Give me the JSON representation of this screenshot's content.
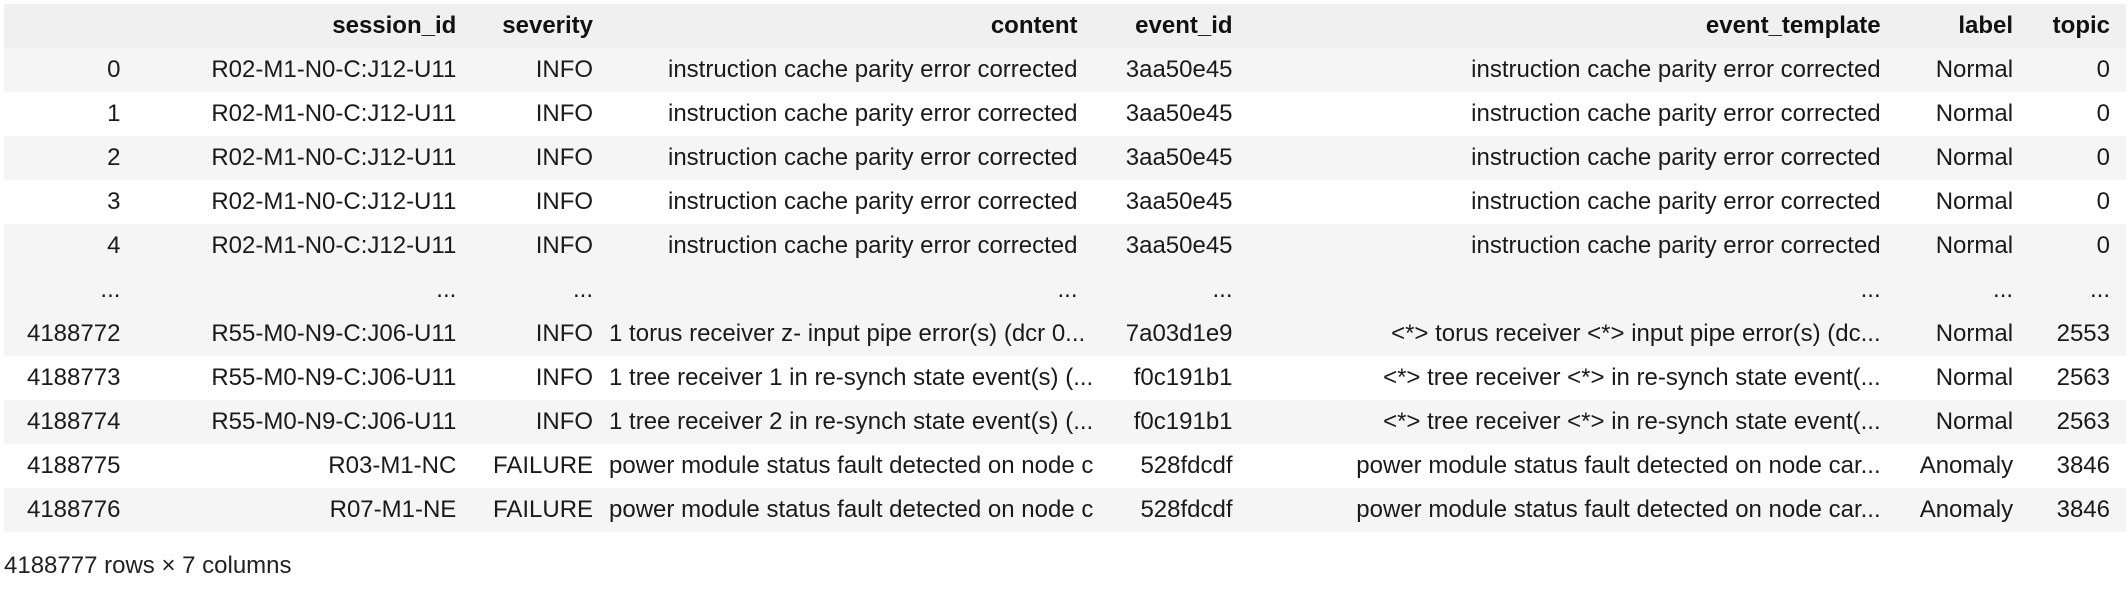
{
  "table": {
    "columns": [
      "",
      "session_id",
      "severity",
      "content",
      "event_id",
      "event_template",
      "label",
      "topic"
    ],
    "rows": [
      [
        "0",
        "R02-M1-N0-C:J12-U11",
        "INFO",
        "instruction cache parity error corrected",
        "3aa50e45",
        "instruction cache parity error corrected",
        "Normal",
        "0"
      ],
      [
        "1",
        "R02-M1-N0-C:J12-U11",
        "INFO",
        "instruction cache parity error corrected",
        "3aa50e45",
        "instruction cache parity error corrected",
        "Normal",
        "0"
      ],
      [
        "2",
        "R02-M1-N0-C:J12-U11",
        "INFO",
        "instruction cache parity error corrected",
        "3aa50e45",
        "instruction cache parity error corrected",
        "Normal",
        "0"
      ],
      [
        "3",
        "R02-M1-N0-C:J12-U11",
        "INFO",
        "instruction cache parity error corrected",
        "3aa50e45",
        "instruction cache parity error corrected",
        "Normal",
        "0"
      ],
      [
        "4",
        "R02-M1-N0-C:J12-U11",
        "INFO",
        "instruction cache parity error corrected",
        "3aa50e45",
        "instruction cache parity error corrected",
        "Normal",
        "0"
      ],
      [
        "...",
        "...",
        "...",
        "...",
        "...",
        "...",
        "...",
        "..."
      ],
      [
        "4188772",
        "R55-M0-N9-C:J06-U11",
        "INFO",
        "1 torus receiver z- input pipe error(s) (dcr 0...",
        "7a03d1e9",
        "<*> torus receiver <*> input pipe error(s) (dc...",
        "Normal",
        "2553"
      ],
      [
        "4188773",
        "R55-M0-N9-C:J06-U11",
        "INFO",
        "1 tree receiver 1 in re-synch state event(s) (...",
        "f0c191b1",
        "<*> tree receiver <*> in re-synch state event(...",
        "Normal",
        "2563"
      ],
      [
        "4188774",
        "R55-M0-N9-C:J06-U11",
        "INFO",
        "1 tree receiver 2 in re-synch state event(s) (...",
        "f0c191b1",
        "<*> tree receiver <*> in re-synch state event(...",
        "Normal",
        "2563"
      ],
      [
        "4188775",
        "R03-M1-NC",
        "FAILURE",
        "power module status fault detected on node car...",
        "528fdcdf",
        "power module status fault detected on node car...",
        "Anomaly",
        "3846"
      ],
      [
        "4188776",
        "R07-M1-NE",
        "FAILURE",
        "power module status fault detected on node car...",
        "528fdcdf",
        "power module status fault detected on node car...",
        "Anomaly",
        "3846"
      ]
    ]
  },
  "footer": {
    "shape_text": "4188777 rows × 7 columns"
  }
}
